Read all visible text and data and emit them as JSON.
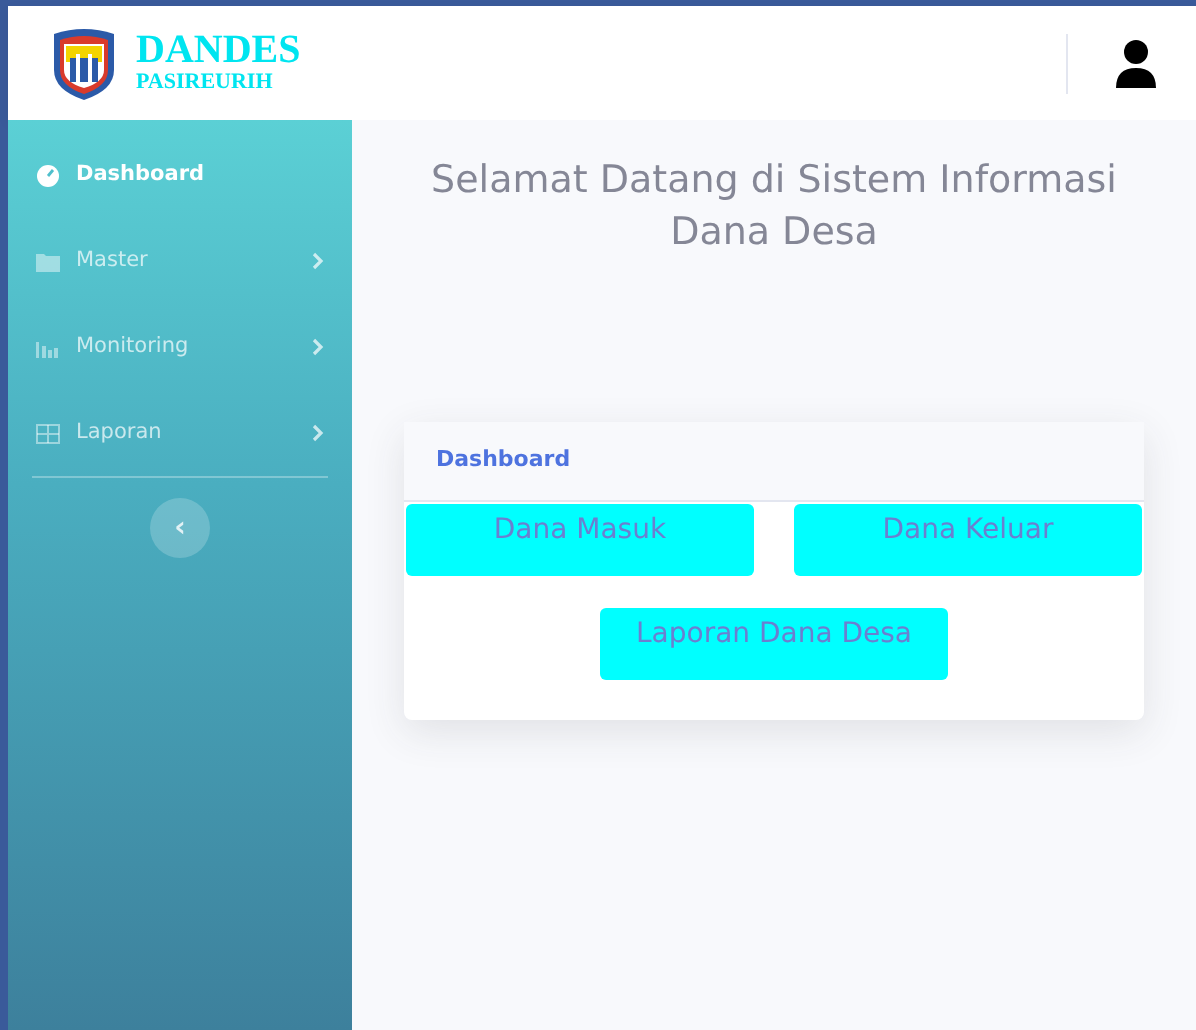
{
  "brand": {
    "title": "DANDES",
    "subtitle": "PASIREURIH"
  },
  "sidebar": {
    "items": [
      {
        "label": "Dashboard",
        "selected": true,
        "submenu": false
      },
      {
        "label": "Master",
        "selected": false,
        "submenu": true
      },
      {
        "label": "Monitoring",
        "selected": false,
        "submenu": true
      },
      {
        "label": "Laporan",
        "selected": false,
        "submenu": true
      }
    ],
    "toggle": "‹"
  },
  "heading": "Selamat Datang di Sistem Informasi Dana Desa",
  "card": {
    "title": "Dashboard",
    "buttons": [
      "Dana Masuk",
      "Dana Keluar",
      "Laporan Dana Desa"
    ]
  }
}
